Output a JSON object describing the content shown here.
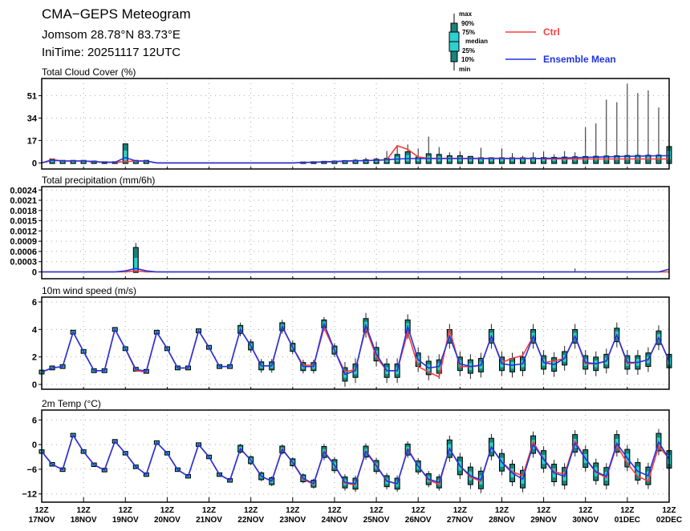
{
  "header": {
    "title": "CMA−GEPS Meteogram",
    "location": "Jomsom 28.78°N 83.73°E",
    "initime": "IniTime: 20251117 12UTC"
  },
  "legend": {
    "box_labels": [
      "max",
      "90%",
      "75%",
      "median",
      "25%",
      "10%",
      "min"
    ],
    "ctrl_label": "Ctrl",
    "mean_label": "Ensemble Mean",
    "ctrl_color": "#ff3b3b",
    "mean_color": "#1f35e0",
    "box_outer_color": "#17837a",
    "box_inner_color": "#2fd0d0"
  },
  "chart_data": {
    "type": "line",
    "time_step_hours": 6,
    "x_ticks": [
      {
        "hour": "12Z",
        "date": "17NOV"
      },
      {
        "hour": "12Z",
        "date": "18NOV"
      },
      {
        "hour": "12Z",
        "date": "19NOV"
      },
      {
        "hour": "12Z",
        "date": "20NOV"
      },
      {
        "hour": "12Z",
        "date": "21NOV"
      },
      {
        "hour": "12Z",
        "date": "22NOV"
      },
      {
        "hour": "12Z",
        "date": "23NOV"
      },
      {
        "hour": "12Z",
        "date": "24NOV"
      },
      {
        "hour": "12Z",
        "date": "25NOV"
      },
      {
        "hour": "12Z",
        "date": "26NOV"
      },
      {
        "hour": "12Z",
        "date": "27NOV"
      },
      {
        "hour": "12Z",
        "date": "28NOV"
      },
      {
        "hour": "12Z",
        "date": "29NOV"
      },
      {
        "hour": "12Z",
        "date": "30NOV"
      },
      {
        "hour": "12Z",
        "date": "01DEC"
      },
      {
        "hour": "12Z",
        "date": "02DEC"
      }
    ],
    "grid": true,
    "panels": [
      {
        "id": "cloud",
        "title": "Total Cloud Cover (%)",
        "ylim": [
          -4.6,
          64
        ],
        "yticks": [
          0,
          17,
          34,
          51
        ],
        "ytick_labels": [
          "0",
          "17",
          "34",
          "51"
        ],
        "mode": "positive",
        "mean": [
          0,
          2,
          1.5,
          1.5,
          1.5,
          1,
          0.5,
          0.5,
          4,
          1.5,
          1.5,
          0,
          0,
          0,
          0,
          0,
          0,
          0,
          0,
          0,
          0,
          0,
          0,
          0,
          0,
          0.3,
          0.5,
          0.8,
          1,
          1.4,
          1.6,
          1.8,
          2,
          2.4,
          2.9,
          3.3,
          3.3,
          3.3,
          3.3,
          3.3,
          3.3,
          3.3,
          3.3,
          3.3,
          3.3,
          3.3,
          3.3,
          3.3,
          3.5,
          3.6,
          3.8,
          4,
          4.2,
          4.4,
          4.6,
          4.8,
          5,
          5.1,
          5.3,
          5.4,
          5.5
        ],
        "ctrl": [
          0,
          2.5,
          1.5,
          1.5,
          1.5,
          1,
          0.5,
          0.5,
          1,
          1.5,
          1.5,
          0,
          0,
          0,
          0,
          0,
          0,
          0,
          0,
          0,
          0,
          0,
          0,
          0,
          0,
          0.3,
          0.5,
          0.8,
          1,
          1.4,
          1.6,
          1.8,
          2,
          2.4,
          13,
          10.3,
          4.5,
          3.5,
          3.5,
          3.5,
          3.5,
          3.5,
          3.5,
          3.5,
          3.5,
          3.5,
          3.5,
          3.5,
          3,
          3,
          3,
          3,
          3,
          3,
          3,
          3,
          3,
          3,
          3,
          3,
          3
        ],
        "p90": [
          0,
          2.5,
          1.5,
          1.5,
          1.5,
          1,
          0.5,
          0.5,
          14,
          1.5,
          1.5,
          0,
          0,
          0,
          0,
          0,
          0,
          0,
          0,
          0,
          0,
          0,
          0,
          0,
          0,
          0.3,
          0.5,
          0.8,
          1,
          1.4,
          1.6,
          2,
          2.4,
          3,
          6,
          8,
          4,
          6.5,
          6,
          5,
          5,
          4.5,
          3.5,
          3.5,
          3.5,
          3.5,
          3.5,
          3.5,
          3.6,
          3.8,
          4,
          4.2,
          4.4,
          4.6,
          4.8,
          5,
          5.2,
          5.3,
          5.4,
          5.5,
          12
        ],
        "max": [
          0,
          2.5,
          1.5,
          1.5,
          1.5,
          1,
          0.5,
          0.5,
          14,
          1.5,
          1.5,
          0,
          0,
          0,
          0,
          0,
          0,
          0,
          0,
          0,
          0,
          0,
          0,
          0,
          0,
          0.5,
          0.8,
          1,
          1.5,
          2,
          3,
          4,
          4,
          9,
          13.5,
          14,
          11,
          20,
          12,
          8,
          8.6,
          3.5,
          11.5,
          4,
          11,
          7.5,
          5.4,
          8,
          8.6,
          6.5,
          9,
          8,
          27,
          30,
          48,
          46,
          60,
          53,
          55,
          42,
          13
        ]
      },
      {
        "id": "precip",
        "title": "Total precipitation (mm/6h)",
        "ylim": [
          -0.0002,
          0.0025
        ],
        "yticks": [
          0,
          0.0003,
          0.0006,
          0.0009,
          0.0012,
          0.0015,
          0.0018,
          0.0021,
          0.0024
        ],
        "ytick_labels": [
          "0",
          "0.0003",
          "0.0006",
          "0.0009",
          "0.0012",
          "0.0015",
          "0.0018",
          "0.0021",
          "0.0024"
        ],
        "mode": "positive",
        "mean": [
          0,
          0,
          0,
          0,
          0,
          0,
          0,
          0,
          3e-05,
          0.0001,
          3e-05,
          0,
          0,
          0,
          0,
          0,
          0,
          0,
          0,
          0,
          0,
          0,
          0,
          0,
          0,
          0,
          0,
          0,
          0,
          0,
          0,
          0,
          0,
          0,
          0,
          0,
          0,
          0,
          0,
          0,
          0,
          0,
          0,
          0,
          0,
          0,
          0,
          0,
          0,
          0,
          0,
          0,
          0,
          0,
          0,
          0,
          0,
          0,
          0,
          0,
          8e-05
        ],
        "ctrl": [
          0,
          0,
          0,
          0,
          0,
          0,
          0,
          0,
          0,
          3e-05,
          0,
          0,
          0,
          0,
          0,
          0,
          0,
          0,
          0,
          0,
          0,
          0,
          0,
          0,
          0,
          0,
          0,
          0,
          0,
          0,
          0,
          0,
          0,
          0,
          0,
          0,
          0,
          0,
          0,
          0,
          0,
          0,
          0,
          0,
          0,
          0,
          0,
          0,
          0,
          0,
          0,
          0,
          0,
          0,
          0,
          0,
          0,
          0,
          0,
          0,
          0
        ],
        "p90": [
          0,
          0,
          0,
          0,
          0,
          0,
          0,
          0,
          0,
          0.0007,
          0,
          0,
          0,
          0,
          0,
          0,
          0,
          0,
          0,
          0,
          0,
          0,
          0,
          0,
          0,
          0,
          0,
          0,
          0,
          0,
          0,
          0,
          0,
          0,
          0,
          0,
          0,
          0,
          0,
          0,
          0,
          0,
          0,
          0,
          0,
          0,
          0,
          0,
          0,
          0,
          0,
          0,
          0,
          0,
          0,
          0,
          0,
          0,
          0,
          0,
          0
        ],
        "max": [
          0,
          0,
          0,
          0,
          0,
          0,
          0,
          0,
          0,
          0.00085,
          0,
          0,
          0,
          0,
          0,
          0,
          0,
          0,
          0,
          0,
          0,
          0,
          0,
          0,
          0,
          0,
          0,
          0,
          0,
          0,
          0,
          0,
          0,
          0,
          0,
          0,
          0,
          0,
          0,
          0,
          0,
          0,
          0,
          0,
          0,
          0,
          0,
          0,
          0,
          0,
          0,
          0.0001,
          0,
          0,
          0,
          0,
          0,
          0,
          0,
          0,
          0
        ]
      },
      {
        "id": "wind",
        "title": "10m wind speed (m/s)",
        "ylim": [
          -0.35,
          6.35
        ],
        "yticks": [
          0,
          2,
          4,
          6
        ],
        "ytick_labels": [
          "0",
          "2",
          "4",
          "6"
        ],
        "mode": "symmetric",
        "mean": [
          0.9,
          1.2,
          1.3,
          3.8,
          2.4,
          1.0,
          1.0,
          4.0,
          2.6,
          1.1,
          0.95,
          3.8,
          2.6,
          1.2,
          1.2,
          3.9,
          2.7,
          1.3,
          1.3,
          4.0,
          2.8,
          1.35,
          1.35,
          4.2,
          2.7,
          1.3,
          1.3,
          4.4,
          2.5,
          0.73,
          1.0,
          4.3,
          2.2,
          1.0,
          1.0,
          4.2,
          1.8,
          1.2,
          1.3,
          3.5,
          1.5,
          1.3,
          1.4,
          3.5,
          1.5,
          1.4,
          1.5,
          3.5,
          1.6,
          1.45,
          1.9,
          3.5,
          1.6,
          1.5,
          1.7,
          3.6,
          1.6,
          1.6,
          1.8,
          3.4,
          1.7
        ],
        "ctrl": [
          0.9,
          1.2,
          1.3,
          3.8,
          2.4,
          1.0,
          1.0,
          4.0,
          2.6,
          1.0,
          0.9,
          3.8,
          2.6,
          1.2,
          1.2,
          3.9,
          2.7,
          1.3,
          1.3,
          4.0,
          2.8,
          1.35,
          1.35,
          4.2,
          2.7,
          1.4,
          1.4,
          4.1,
          2.5,
          0.9,
          1.1,
          4.1,
          2.0,
          1.0,
          1.0,
          3.8,
          1.3,
          0.9,
          0.55,
          4.0,
          1.3,
          1.3,
          1.4,
          3.5,
          1.6,
          1.9,
          2.1,
          3.5,
          1.6,
          1.7,
          1.9,
          3.5,
          1.5,
          1.5,
          1.7,
          3.6,
          1.5,
          1.6,
          1.8,
          3.4,
          1.7
        ],
        "spread_10_90": [
          0.1,
          0.1,
          0.1,
          0.1,
          0.1,
          0.1,
          0.1,
          0.1,
          0.1,
          0.1,
          0.1,
          0.1,
          0.1,
          0.1,
          0.1,
          0.1,
          0.1,
          0.1,
          0.1,
          0.25,
          0.25,
          0.25,
          0.25,
          0.25,
          0.25,
          0.25,
          0.25,
          0.25,
          0.25,
          0.45,
          0.45,
          0.45,
          0.45,
          0.45,
          0.45,
          0.45,
          0.45,
          0.45,
          0.45,
          0.45,
          0.45,
          0.45,
          0.45,
          0.45,
          0.45,
          0.45,
          0.45,
          0.45,
          0.45,
          0.45,
          0.45,
          0.45,
          0.45,
          0.45,
          0.45,
          0.45,
          0.45,
          0.45,
          0.45,
          0.45,
          0.45
        ],
        "spread_min_max": [
          0.15,
          0.15,
          0.15,
          0.15,
          0.15,
          0.15,
          0.15,
          0.15,
          0.15,
          0.15,
          0.15,
          0.15,
          0.15,
          0.15,
          0.15,
          0.15,
          0.15,
          0.15,
          0.15,
          0.5,
          0.5,
          0.5,
          0.5,
          0.5,
          0.5,
          0.5,
          0.5,
          0.5,
          0.5,
          0.9,
          0.9,
          0.9,
          0.9,
          0.9,
          0.9,
          0.9,
          0.9,
          0.9,
          0.9,
          0.9,
          0.9,
          0.9,
          0.9,
          0.9,
          0.9,
          0.9,
          0.9,
          0.9,
          0.9,
          0.9,
          0.9,
          0.9,
          0.9,
          0.9,
          0.9,
          0.9,
          0.9,
          0.9,
          0.9,
          0.9,
          0.9
        ]
      },
      {
        "id": "temp",
        "title": "2m Temp (°C)",
        "ylim": [
          -14,
          8.4
        ],
        "yticks": [
          -12,
          -6,
          0,
          6
        ],
        "ytick_labels": [
          "−12",
          "−6",
          "0",
          "6"
        ],
        "mode": "symmetric",
        "mean": [
          -1.7,
          -4.8,
          -6.1,
          2.3,
          -1.7,
          -4.9,
          -6.2,
          0.8,
          -2.1,
          -5.4,
          -7.3,
          0.5,
          -2.1,
          -6.1,
          -7.7,
          0,
          -3.0,
          -7.3,
          -8.7,
          -1.0,
          -3.8,
          -7.7,
          -8.9,
          -1.2,
          -4.3,
          -8.2,
          -9.5,
          -1.8,
          -5.0,
          -9.2,
          -9.5,
          -1.7,
          -5.2,
          -8.9,
          -9.5,
          -1.2,
          -5.3,
          -8.4,
          -9.2,
          -1.0,
          -5.2,
          -7.6,
          -8.6,
          -0.6,
          -4.3,
          -6.9,
          -8.4,
          0,
          -3.6,
          -6.9,
          -7.7,
          0.3,
          -3.4,
          -6.6,
          -7.7,
          0.3,
          -3.3,
          -6.5,
          -7.6,
          0.6,
          -3.6
        ],
        "ctrl": [
          -1.7,
          -4.8,
          -6.1,
          2.3,
          -1.7,
          -4.9,
          -6.2,
          0.8,
          -2.1,
          -5.4,
          -7.3,
          0.5,
          -2.1,
          -6.1,
          -7.7,
          0,
          -3.0,
          -7.3,
          -8.7,
          -1.0,
          -3.8,
          -7.7,
          -8.9,
          -1.0,
          -4.4,
          -8.4,
          -9.7,
          -1.6,
          -5.0,
          -9.4,
          -9.8,
          -1.5,
          -5.0,
          -8.8,
          -9.6,
          -1.0,
          -5.2,
          -8.6,
          -9.7,
          -1.0,
          -5.2,
          -7.9,
          -8.9,
          -0.6,
          -4.2,
          -6.6,
          -7.6,
          0.6,
          -3.5,
          -6.6,
          -7.2,
          0.8,
          -3.4,
          -6.8,
          -8.0,
          -0.2,
          -4.6,
          -7.7,
          -8.9,
          -0.4,
          -3.4
        ],
        "spread_10_90": [
          0.3,
          0.3,
          0.3,
          0.3,
          0.3,
          0.3,
          0.3,
          0.3,
          0.3,
          0.3,
          0.3,
          0.3,
          0.3,
          0.3,
          0.3,
          0.3,
          0.3,
          0.3,
          0.3,
          0.7,
          0.7,
          0.7,
          0.7,
          0.7,
          0.7,
          0.7,
          0.7,
          1.2,
          1.2,
          1.2,
          1.2,
          1.2,
          1.2,
          1.2,
          1.2,
          1.2,
          1.2,
          1.2,
          1.2,
          2,
          2,
          2,
          2,
          2,
          2,
          2,
          2,
          2,
          2,
          2,
          2,
          2,
          2,
          2,
          2,
          2,
          2,
          2,
          2,
          2,
          2
        ],
        "spread_min_max": [
          0.5,
          0.5,
          0.5,
          0.5,
          0.5,
          0.5,
          0.5,
          0.5,
          0.5,
          0.5,
          0.5,
          0.5,
          0.5,
          0.5,
          0.5,
          0.5,
          0.5,
          0.5,
          0.5,
          1.2,
          1.2,
          1.2,
          1.2,
          1.2,
          1.2,
          1.2,
          1.2,
          2,
          2,
          2,
          2,
          2,
          2,
          2,
          2,
          2,
          2,
          2,
          2,
          3.2,
          3.2,
          3.2,
          3.2,
          3.2,
          3.2,
          3.2,
          3.2,
          3.2,
          3.2,
          3.2,
          3.2,
          3.2,
          3.2,
          3.2,
          3.2,
          3.2,
          3.2,
          3.2,
          3.2,
          3.2,
          3.2
        ]
      }
    ]
  }
}
